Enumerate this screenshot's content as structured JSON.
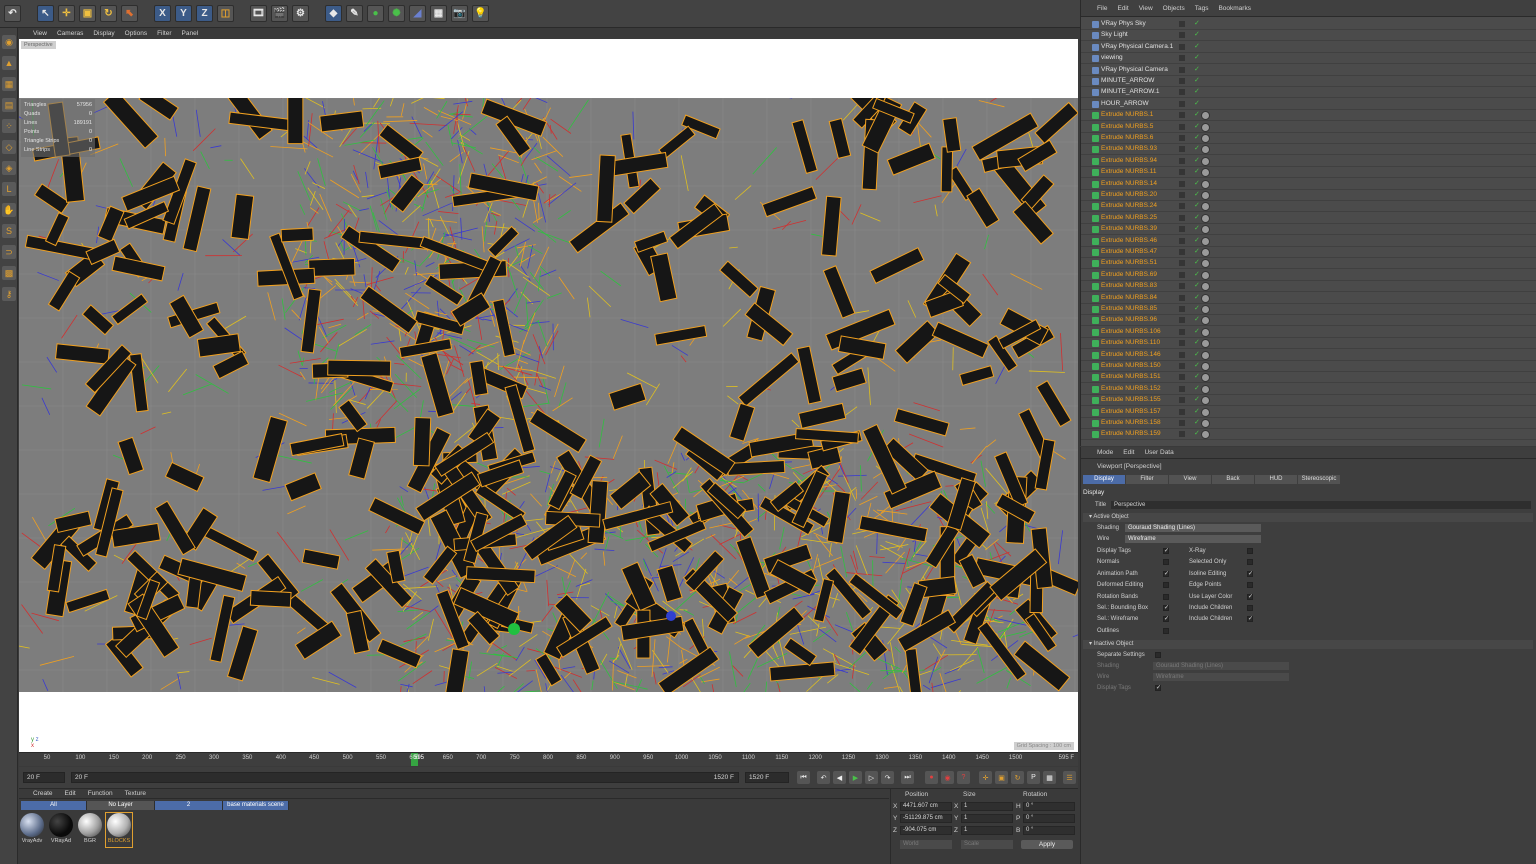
{
  "toolbar": {
    "icons": [
      "undo-icon",
      "select-icon",
      "move-icon",
      "scale-icon",
      "rotate-icon",
      "live-select-icon",
      "x-axis-icon",
      "y-axis-icon",
      "z-axis-icon",
      "coordinate-system-icon",
      "render-view-icon",
      "render-icon",
      "render-settings-icon",
      "cube-icon",
      "pen-icon",
      "subdivision-icon",
      "array-icon",
      "deformer-icon",
      "floor-icon",
      "camera-icon",
      "light-icon"
    ],
    "axis_labels": [
      "X",
      "Y",
      "Z"
    ]
  },
  "viewport_menu": [
    "View",
    "Cameras",
    "Display",
    "Options",
    "Filter",
    "Panel"
  ],
  "viewport": {
    "label": "Perspective",
    "status": "Grid Spacing : 100 cm",
    "hud": [
      {
        "label": "Triangles",
        "value": "57956"
      },
      {
        "label": "Quads",
        "value": "0"
      },
      {
        "label": "Lines",
        "value": "189191"
      },
      {
        "label": "Points",
        "value": "0"
      },
      {
        "label": "Triangle Strips",
        "value": "0"
      },
      {
        "label": "Line Strips",
        "value": "0"
      }
    ],
    "axis_y": "y",
    "axis_z": "z",
    "axis_x": "x"
  },
  "timeline": {
    "ticks": [
      "50",
      "100",
      "150",
      "200",
      "250",
      "300",
      "350",
      "400",
      "450",
      "500",
      "550",
      "600",
      "650",
      "700",
      "750",
      "800",
      "850",
      "900",
      "950",
      "1000",
      "1050",
      "1100",
      "1150",
      "1200",
      "1250",
      "1300",
      "1350",
      "1400",
      "1450",
      "1500"
    ],
    "playhead_label": "595",
    "frame_display": "595 F"
  },
  "transport": {
    "start": "20 F",
    "current": "20 F",
    "end_a": "1520 F",
    "end_b": "1520 F"
  },
  "materials": {
    "menu": [
      "Create",
      "Edit",
      "Function",
      "Texture"
    ],
    "layers": [
      "All",
      "No Layer",
      "2",
      "base materials scene"
    ],
    "items": [
      {
        "label": "VrayAdv",
        "color": "#8a9ab5"
      },
      {
        "label": "VRayAd",
        "color": "#111111"
      },
      {
        "label": "BGR",
        "color": "#c8c8c8"
      },
      {
        "label": "BLOCKS",
        "color": "#cfcfcf"
      }
    ]
  },
  "coords": {
    "headers": [
      "Position",
      "Size",
      "Rotation"
    ],
    "rows": [
      {
        "axis": "X",
        "pos": "4471.607 cm",
        "size_axis": "X",
        "size": "1",
        "rot_axis": "H",
        "rot": "0 °"
      },
      {
        "axis": "Y",
        "pos": "-51129.875 cm",
        "size_axis": "Y",
        "size": "1",
        "rot_axis": "P",
        "rot": "0 °"
      },
      {
        "axis": "Z",
        "pos": "-904.075 cm",
        "size_axis": "Z",
        "size": "1",
        "rot_axis": "B",
        "rot": "0 °"
      }
    ],
    "mode_a": "World",
    "mode_b": "Scale",
    "apply": "Apply"
  },
  "object_manager": {
    "menu": [
      "File",
      "Edit",
      "View",
      "Objects",
      "Tags",
      "Bookmarks"
    ],
    "objects": [
      {
        "name": "VRay Phys Sky",
        "orange": false
      },
      {
        "name": "Sky Light",
        "orange": false
      },
      {
        "name": "VRay Physical Camera.1",
        "orange": false
      },
      {
        "name": "viewing",
        "orange": false
      },
      {
        "name": "VRay Physical Camera",
        "orange": false
      },
      {
        "name": "MINUTE_ARROW",
        "orange": false
      },
      {
        "name": "MINUTE_ARROW.1",
        "orange": false
      },
      {
        "name": "HOUR_ARROW",
        "orange": false
      },
      {
        "name": "Extrude NURBS.1",
        "orange": true
      },
      {
        "name": "Extrude NURBS.5",
        "orange": true
      },
      {
        "name": "Extrude NURBS.6",
        "orange": true
      },
      {
        "name": "Extrude NURBS.93",
        "orange": true
      },
      {
        "name": "Extrude NURBS.94",
        "orange": true
      },
      {
        "name": "Extrude NURBS.11",
        "orange": true
      },
      {
        "name": "Extrude NURBS.14",
        "orange": true
      },
      {
        "name": "Extrude NURBS.20",
        "orange": true
      },
      {
        "name": "Extrude NURBS.24",
        "orange": true
      },
      {
        "name": "Extrude NURBS.25",
        "orange": true
      },
      {
        "name": "Extrude NURBS.39",
        "orange": true
      },
      {
        "name": "Extrude NURBS.46",
        "orange": true
      },
      {
        "name": "Extrude NURBS.47",
        "orange": true
      },
      {
        "name": "Extrude NURBS.51",
        "orange": true
      },
      {
        "name": "Extrude NURBS.69",
        "orange": true
      },
      {
        "name": "Extrude NURBS.83",
        "orange": true
      },
      {
        "name": "Extrude NURBS.84",
        "orange": true
      },
      {
        "name": "Extrude NURBS.85",
        "orange": true
      },
      {
        "name": "Extrude NURBS.96",
        "orange": true
      },
      {
        "name": "Extrude NURBS.106",
        "orange": true
      },
      {
        "name": "Extrude NURBS.110",
        "orange": true
      },
      {
        "name": "Extrude NURBS.146",
        "orange": true
      },
      {
        "name": "Extrude NURBS.150",
        "orange": true
      },
      {
        "name": "Extrude NURBS.151",
        "orange": true
      },
      {
        "name": "Extrude NURBS.152",
        "orange": true
      },
      {
        "name": "Extrude NURBS.155",
        "orange": true
      },
      {
        "name": "Extrude NURBS.157",
        "orange": true
      },
      {
        "name": "Extrude NURBS.158",
        "orange": true
      },
      {
        "name": "Extrude NURBS.159",
        "orange": true
      }
    ]
  },
  "attributes": {
    "menu": [
      "Mode",
      "Edit",
      "User Data"
    ],
    "title": "Viewport [Perspective]",
    "tabs": [
      "Display",
      "Filter",
      "View",
      "Back",
      "HUD",
      "Stereoscopic"
    ],
    "section": "Display",
    "title_label": "Title",
    "title_value": "Perspective",
    "active_object": "Active Object",
    "shading_label": "Shading",
    "shading_value": "Gouraud Shading (Lines)",
    "wire_label": "Wire",
    "wire_value": "Wireframe",
    "left_props": [
      "Display Tags",
      "Normals",
      "Animation Path",
      "Deformed Editing",
      "Rotation Bands",
      "Sel.: Bounding Box",
      "Sel.: Wireframe",
      "Outlines"
    ],
    "right_props": [
      "X-Ray",
      "Selected Only",
      "Isoline Editing",
      "Edge Points",
      "Use Layer Color",
      "Include Children",
      "Include Children"
    ],
    "inactive_object": "Inactive Object",
    "separate_settings": "Separate Settings",
    "inactive_shading_value": "Gouraud Shading (Lines)",
    "inactive_wire_value": "Wireframe",
    "inactive_display_tags": "Display Tags"
  }
}
